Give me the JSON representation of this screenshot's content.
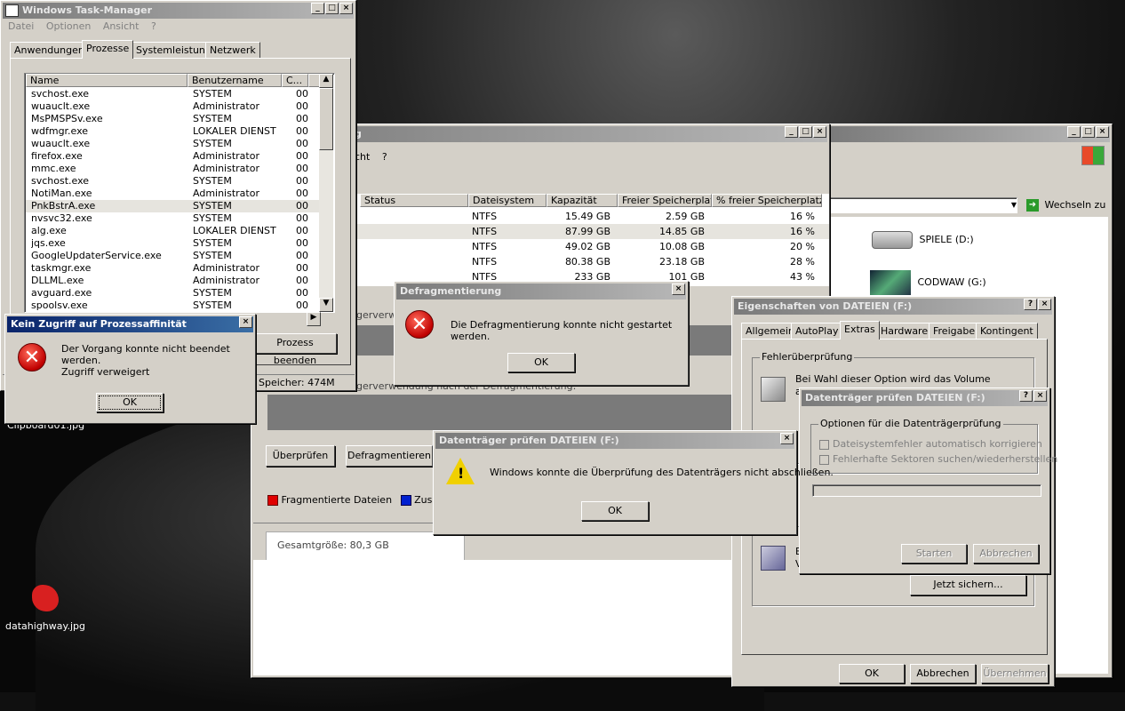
{
  "desktop": {
    "icons": [
      {
        "label": "Clipboard01.jpg"
      },
      {
        "label": "datahighway.jpg"
      }
    ]
  },
  "task_manager": {
    "title": "Windows Task-Manager",
    "menu": [
      "Datei",
      "Optionen",
      "Ansicht",
      "?"
    ],
    "tabs": [
      "Anwendungen",
      "Prozesse",
      "Systemleistung",
      "Netzwerk"
    ],
    "columns": [
      "Name",
      "Benutzername",
      "C..."
    ],
    "processes": [
      {
        "name": "svchost.exe",
        "user": "SYSTEM",
        "cpu": "00"
      },
      {
        "name": "wuauclt.exe",
        "user": "Administrator",
        "cpu": "00"
      },
      {
        "name": "MsPMSPSv.exe",
        "user": "SYSTEM",
        "cpu": "00"
      },
      {
        "name": "wdfmgr.exe",
        "user": "LOKALER DIENST",
        "cpu": "00"
      },
      {
        "name": "wuauclt.exe",
        "user": "SYSTEM",
        "cpu": "00"
      },
      {
        "name": "firefox.exe",
        "user": "Administrator",
        "cpu": "00"
      },
      {
        "name": "mmc.exe",
        "user": "Administrator",
        "cpu": "00"
      },
      {
        "name": "svchost.exe",
        "user": "SYSTEM",
        "cpu": "00"
      },
      {
        "name": "NotiMan.exe",
        "user": "Administrator",
        "cpu": "00"
      },
      {
        "name": "PnkBstrA.exe",
        "user": "SYSTEM",
        "cpu": "00"
      },
      {
        "name": "nvsvc32.exe",
        "user": "SYSTEM",
        "cpu": "00"
      },
      {
        "name": "alg.exe",
        "user": "LOKALER DIENST",
        "cpu": "00"
      },
      {
        "name": "jqs.exe",
        "user": "SYSTEM",
        "cpu": "00"
      },
      {
        "name": "GoogleUpdaterService.exe",
        "user": "SYSTEM",
        "cpu": "00"
      },
      {
        "name": "taskmgr.exe",
        "user": "Administrator",
        "cpu": "00"
      },
      {
        "name": "DLLML.exe",
        "user": "Administrator",
        "cpu": "00"
      },
      {
        "name": "avguard.exe",
        "user": "SYSTEM",
        "cpu": "00"
      },
      {
        "name": "spoolsv.exe",
        "user": "SYSTEM",
        "cpu": "00"
      }
    ],
    "end_process_label": "Prozess beenden",
    "status_memory": "Speicher: 474M"
  },
  "affinity_dialog": {
    "title": "Kein Zugriff auf Prozessaffinität",
    "message": "Der Vorgang konnte nicht beendet werden.",
    "detail": "Zugriff verweigert",
    "ok": "OK"
  },
  "defrag_window": {
    "title_fragment": "g",
    "menu": [
      "cht",
      "?"
    ],
    "columns": [
      "Status",
      "Dateisystem",
      "Kapazität",
      "Freier Speicherplatz",
      "% freier Speicherplatz"
    ],
    "volumes": [
      {
        "fs": "NTFS",
        "cap": "15.49 GB",
        "free": "2.59 GB",
        "pct": "16 %"
      },
      {
        "fs": "NTFS",
        "cap": "87.99 GB",
        "free": "14.85 GB",
        "pct": "16 %"
      },
      {
        "fs": "NTFS",
        "cap": "49.02 GB",
        "free": "10.08 GB",
        "pct": "20 %"
      },
      {
        "fs": "NTFS",
        "cap": "80.38 GB",
        "free": "23.18 GB",
        "pct": "28 %"
      },
      {
        "fs": "NTFS",
        "cap": "233 GB",
        "free": "101 GB",
        "pct": "43 %"
      }
    ],
    "label_before": "gerverwe",
    "label_after": "gerverwendung nach der Defragmentierung:",
    "btn_check": "Überprüfen",
    "btn_defrag": "Defragmentieren",
    "legend_fragmented": "Fragmentierte Dateien",
    "legend_contiguous": "Zusam",
    "total_size": "Gesamtgröße: 80,3 GB"
  },
  "defrag_dialog": {
    "title": "Defragmentierung",
    "message": "Die Defragmentierung konnte nicht gestartet werden.",
    "ok": "OK"
  },
  "check_dialog": {
    "title": "Datenträger prüfen DATEIEN (F:)",
    "message": "Windows konnte die Überprüfung des Datenträgers nicht abschließen.",
    "ok": "OK"
  },
  "explorer": {
    "go_label": "Wechseln zu",
    "drives": [
      {
        "label": "SPIELE (D:)"
      },
      {
        "label": "CODWAW (G:)"
      }
    ]
  },
  "properties": {
    "title": "Eigenschaften von DATEIEN (F:)",
    "tabs": [
      "Allgemein",
      "AutoPlay",
      "Extras",
      "Hardware",
      "Freigabe",
      "Kontingent"
    ],
    "group_error": "Fehlerüberprüfung",
    "error_text": "Bei Wahl dieser Option wird das Volume",
    "error_text2": "a",
    "backup_text": "B",
    "backup_text2": "V",
    "backup_button": "Jetzt sichern...",
    "ok": "OK",
    "cancel": "Abbrechen",
    "apply": "Übernehmen"
  },
  "check_options": {
    "title": "Datenträger prüfen DATEIEN (F:)",
    "group": "Optionen für die Datenträgerprüfung",
    "opt1": "Dateisystemfehler automatisch korrigieren",
    "opt2": "Fehlerhafte Sektoren suchen/wiederherstellen",
    "start": "Starten",
    "cancel": "Abbrechen"
  }
}
